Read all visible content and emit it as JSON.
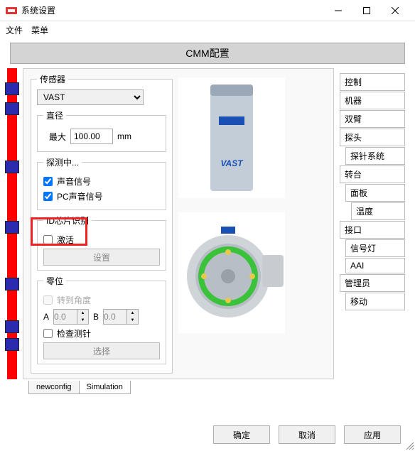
{
  "window": {
    "title": "系统设置"
  },
  "menu": {
    "file": "文件",
    "menu": "菜单"
  },
  "banner": "CMM配置",
  "sensor": {
    "legend": "传感器",
    "selected": "VAST",
    "diameter": {
      "legend": "直径",
      "max_label": "最大",
      "value": "100.00",
      "unit": "mm"
    },
    "probing": {
      "legend": "探测中...",
      "sound": "声音信号",
      "pc_sound": "PC声音信号"
    },
    "idchip": {
      "legend": "ID芯片识别",
      "activate": "激活",
      "settings_btn": "设置"
    },
    "zero": {
      "legend": "零位",
      "rotate": "转到角度",
      "A": "A",
      "B": "B",
      "a_val": "0.0",
      "b_val": "0.0",
      "check_stylus": "检查测针",
      "select_btn": "选择"
    }
  },
  "sidebar": {
    "items": [
      {
        "label": "控制",
        "indent": 0
      },
      {
        "label": "机器",
        "indent": 0
      },
      {
        "label": "双臂",
        "indent": 0
      },
      {
        "label": "探头",
        "indent": 0
      },
      {
        "label": "探针系统",
        "indent": 1
      },
      {
        "label": "转台",
        "indent": 0
      },
      {
        "label": "面板",
        "indent": 1
      },
      {
        "label": "温度",
        "indent": 2
      },
      {
        "label": "接口",
        "indent": 0
      },
      {
        "label": "信号灯",
        "indent": 1
      },
      {
        "label": "AAI",
        "indent": 1
      },
      {
        "label": "管理员",
        "indent": 0
      },
      {
        "label": "移动",
        "indent": 1
      }
    ]
  },
  "tabs": {
    "t1": "newconfig",
    "t2": "Simulation"
  },
  "footer": {
    "ok": "确定",
    "cancel": "取消",
    "apply": "应用"
  }
}
